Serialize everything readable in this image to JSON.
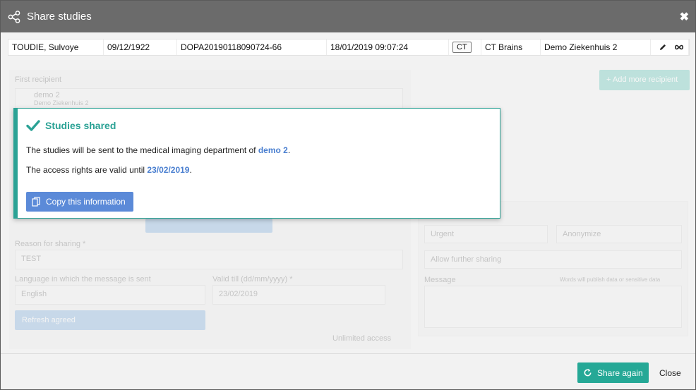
{
  "dialog": {
    "title": "Share studies",
    "close_symbol": "✖"
  },
  "study": {
    "patient_name": "TOUDIE, Sulvoye",
    "birth_date": "09/12/1922",
    "accession": "DOPA20190118090724-66",
    "study_datetime": "18/01/2019 09:07:24",
    "modality": "CT",
    "description": "CT Brains",
    "institution": "Demo Ziekenhuis 2"
  },
  "background": {
    "first_recipient_label": "First recipient",
    "recipient_name": "demo 2",
    "recipient_sub": "Demo Ziekenhuis 2",
    "add_recipient_label": "+ Add more recipient",
    "reason_label": "Reason for sharing *",
    "reason_value": "TEST",
    "language_label": "Language in which the message is sent",
    "language_value": "English",
    "valid_till_label": "Valid till (dd/mm/yyyy) *",
    "valid_till_value": "23/02/2019",
    "unlimited_label": "Unlimited access",
    "urgent_label": "Urgent",
    "anonymize_label": "Anonymize",
    "further_sharing_label": "Allow further sharing",
    "message_label": "Message",
    "message_hint": "Words will publish data or sensitive data",
    "refresh_label": "Refresh agreed"
  },
  "popup": {
    "heading": "Studies shared",
    "line1_prefix": "The studies will be sent to the medical imaging department of ",
    "line1_highlight": "demo 2",
    "line1_suffix": ".",
    "line2_prefix": "The access rights are valid until ",
    "line2_highlight": "23/02/2019",
    "line2_suffix": ".",
    "copy_label": "Copy this information"
  },
  "footer": {
    "share_again_label": "Share again",
    "close_label": "Close"
  },
  "colors": {
    "titlebar": "#6b6b6b",
    "accent_teal": "#2ba295",
    "link_blue": "#4a7fd0",
    "copy_button": "#5b8ad8",
    "share_again": "#25a896"
  }
}
